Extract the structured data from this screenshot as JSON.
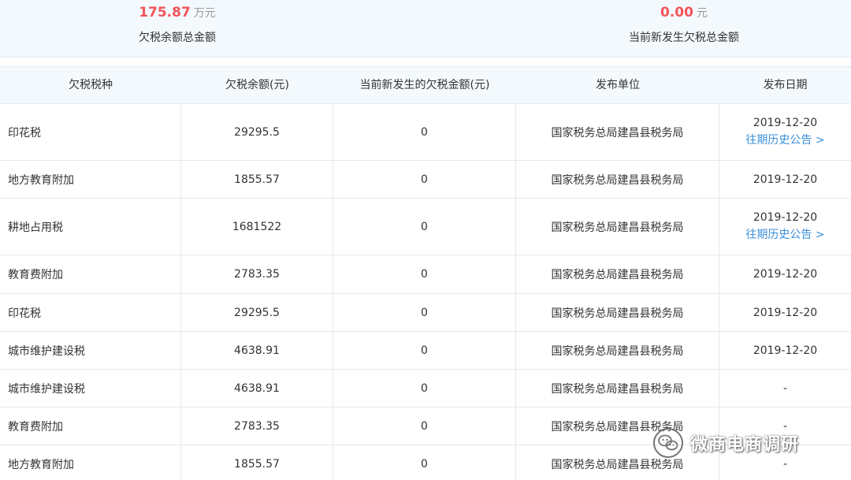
{
  "summary": {
    "balance_value": "175.87",
    "balance_unit": "万元",
    "balance_label": "欠税余额总金额",
    "new_value": "0.00",
    "new_unit": "元",
    "new_label": "当前新发生欠税总金额"
  },
  "table": {
    "headers": [
      "欠税税种",
      "欠税余额(元)",
      "当前新发生的欠税金额(元)",
      "发布单位",
      "发布日期"
    ],
    "history_link_label": "往期历史公告 >",
    "rows": [
      {
        "type": "印花税",
        "balance": "29295.5",
        "new": "0",
        "unit": "国家税务总局建昌县税务局",
        "date": "2019-12-20",
        "link": "往期历史公告 >"
      },
      {
        "type": "地方教育附加",
        "balance": "1855.57",
        "new": "0",
        "unit": "国家税务总局建昌县税务局",
        "date": "2019-12-20"
      },
      {
        "type": "耕地占用税",
        "balance": "1681522",
        "new": "0",
        "unit": "国家税务总局建昌县税务局",
        "date": "2019-12-20",
        "link": "往期历史公告 >"
      },
      {
        "type": "教育费附加",
        "balance": "2783.35",
        "new": "0",
        "unit": "国家税务总局建昌县税务局",
        "date": "2019-12-20"
      },
      {
        "type": "印花税",
        "balance": "29295.5",
        "new": "0",
        "unit": "国家税务总局建昌县税务局",
        "date": "2019-12-20"
      },
      {
        "type": "城市维护建设税",
        "balance": "4638.91",
        "new": "0",
        "unit": "国家税务总局建昌县税务局",
        "date": "2019-12-20"
      },
      {
        "type": "城市维护建设税",
        "balance": "4638.91",
        "new": "0",
        "unit": "国家税务总局建昌县税务局",
        "date": "-"
      },
      {
        "type": "教育费附加",
        "balance": "2783.35",
        "new": "0",
        "unit": "国家税务总局建昌县税务局",
        "date": "-"
      },
      {
        "type": "地方教育附加",
        "balance": "1855.57",
        "new": "0",
        "unit": "国家税务总局建昌县税务局",
        "date": "-"
      }
    ]
  },
  "watermark": {
    "text": "微商电商调研",
    "icon": "wechat-icon"
  }
}
